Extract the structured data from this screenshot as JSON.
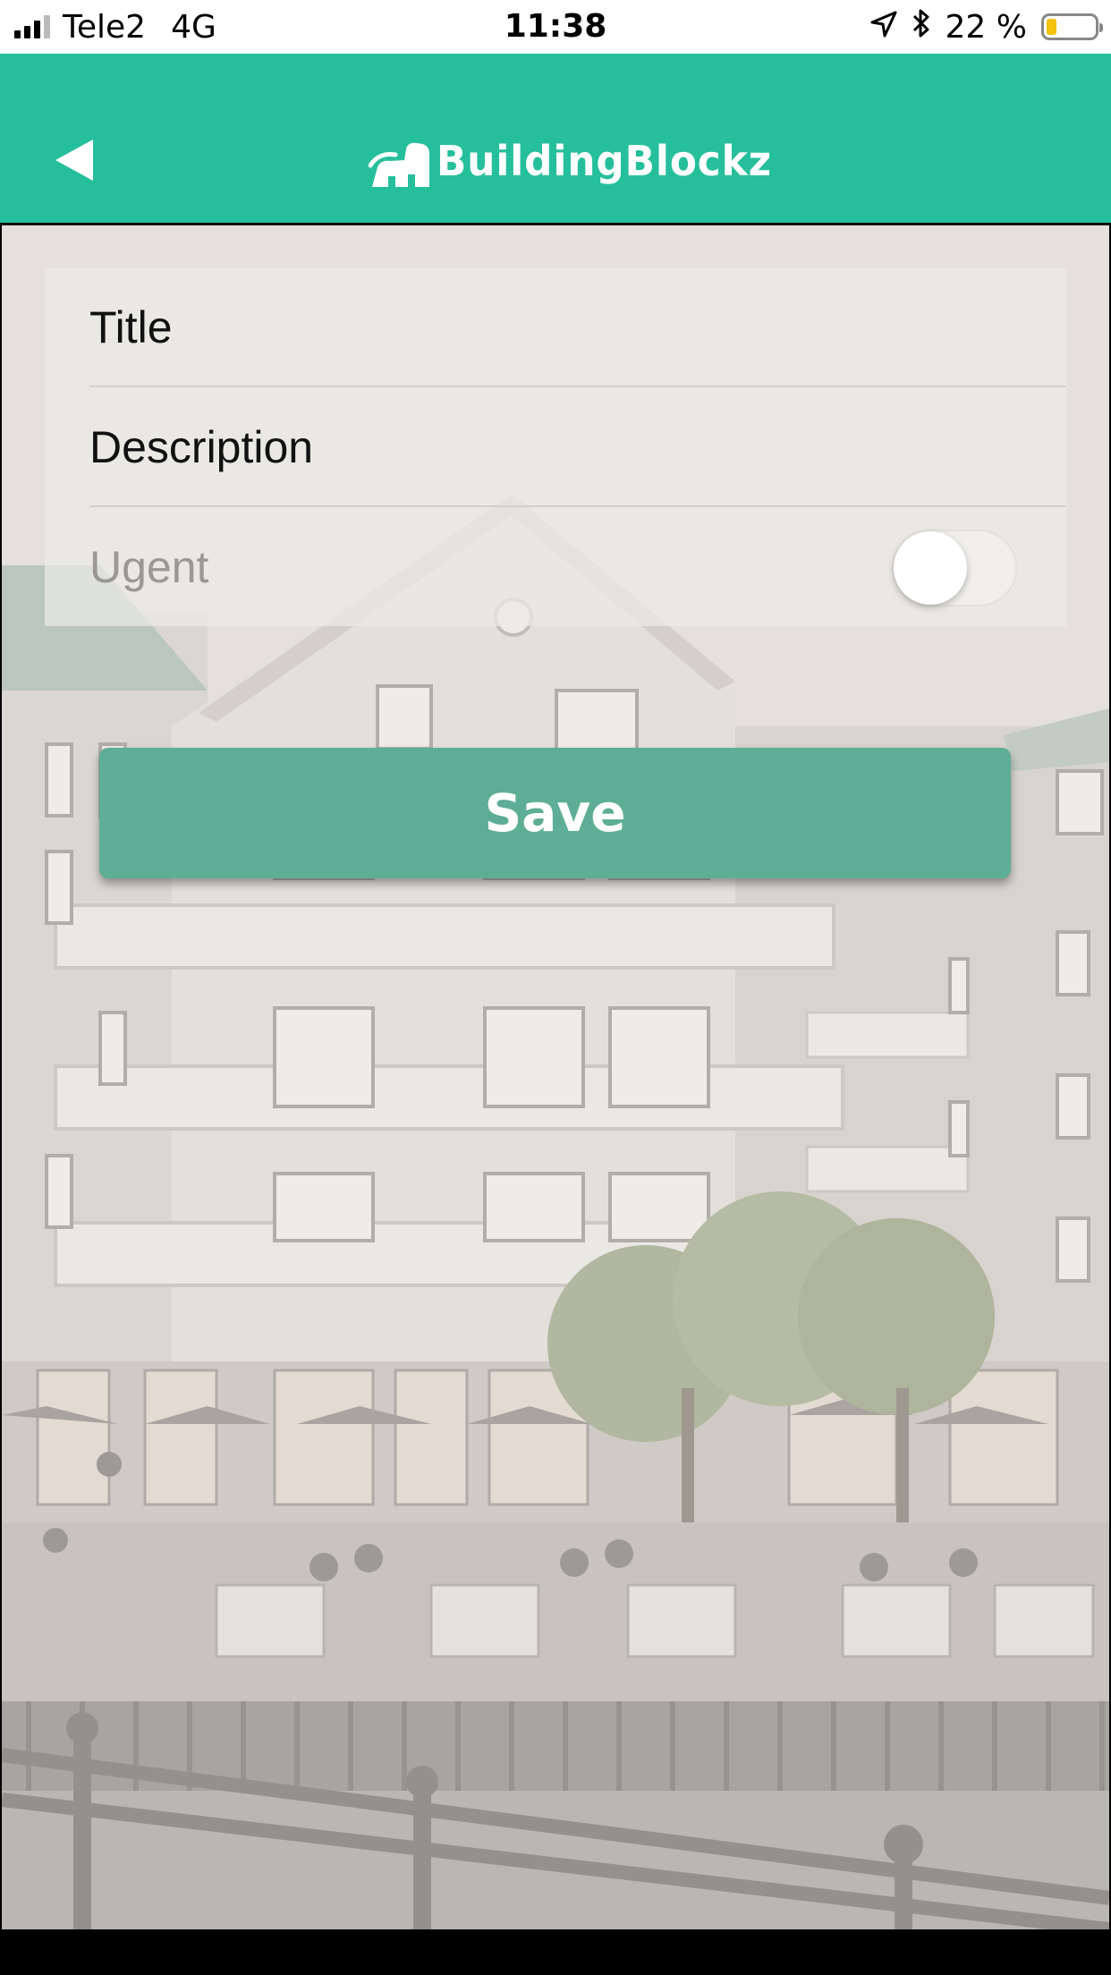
{
  "status_bar": {
    "carrier": "Tele2",
    "network": "4G",
    "time": "11:38",
    "battery_percent": "22 %",
    "battery_level": 0.22,
    "icons": [
      "signal-icon",
      "location-arrow-icon",
      "bluetooth-icon",
      "battery-icon"
    ]
  },
  "header": {
    "app_name": "BuildingBlockz",
    "back_icon": "back-arrow-icon",
    "background_color": "#26bf9c"
  },
  "form": {
    "title_placeholder": "Title",
    "description_placeholder": "Description",
    "urgent_label": "Ugent",
    "urgent_on": false
  },
  "actions": {
    "save_label": "Save",
    "save_color": "#5eae96"
  }
}
